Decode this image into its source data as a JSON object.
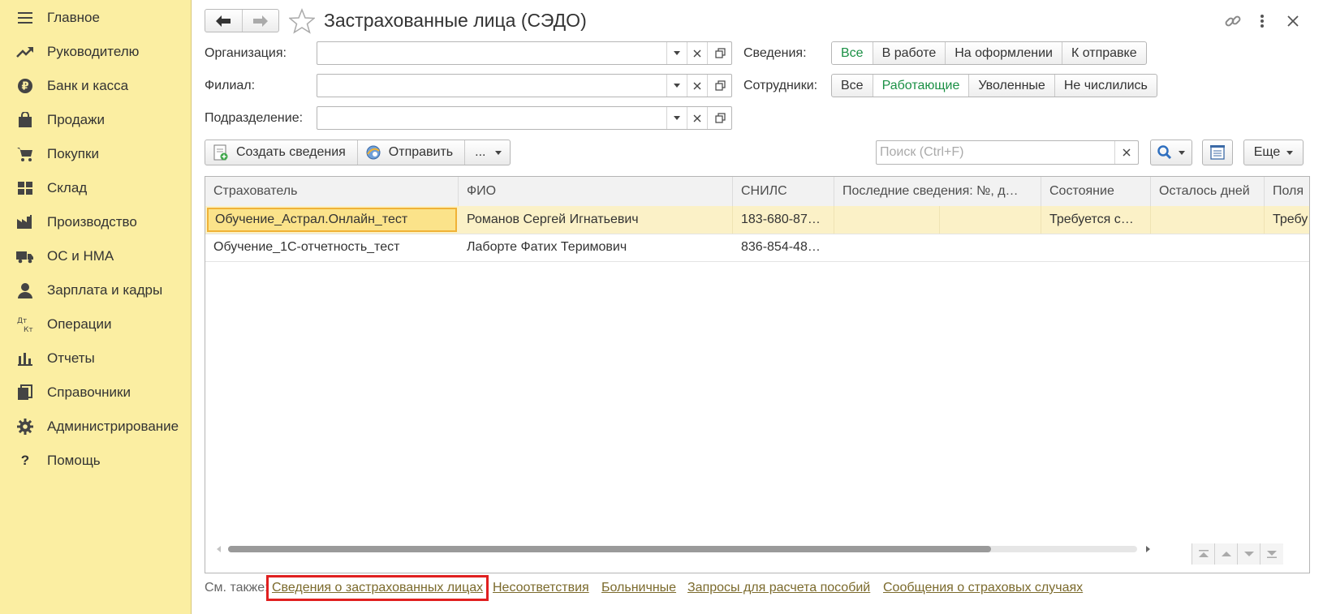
{
  "sidebar": {
    "items": [
      {
        "label": "Главное",
        "icon": "menu-icon"
      },
      {
        "label": "Руководителю",
        "icon": "trend-icon"
      },
      {
        "label": "Банк и касса",
        "icon": "ruble-icon"
      },
      {
        "label": "Продажи",
        "icon": "bag-icon"
      },
      {
        "label": "Покупки",
        "icon": "cart-icon"
      },
      {
        "label": "Склад",
        "icon": "warehouse-icon"
      },
      {
        "label": "Производство",
        "icon": "factory-icon"
      },
      {
        "label": "ОС и НМА",
        "icon": "truck-icon"
      },
      {
        "label": "Зарплата и кадры",
        "icon": "person-icon"
      },
      {
        "label": "Операции",
        "icon": "dt-kt-icon"
      },
      {
        "label": "Отчеты",
        "icon": "chart-icon"
      },
      {
        "label": "Справочники",
        "icon": "books-icon"
      },
      {
        "label": "Администрирование",
        "icon": "gear-icon"
      },
      {
        "label": "Помощь",
        "icon": "help-icon"
      }
    ],
    "dt": "Дт",
    "kt": "Кт",
    "help_glyph": "?"
  },
  "header": {
    "title": "Застрахованные лица (СЭДО)"
  },
  "filters": {
    "organization_label": "Организация:",
    "branch_label": "Филиал:",
    "department_label": "Подразделение:",
    "organization_value": "",
    "branch_value": "",
    "department_value": ""
  },
  "info_filter": {
    "label": "Сведения:",
    "options": [
      "Все",
      "В работе",
      "На оформлении",
      "К отправке"
    ],
    "active": "Все"
  },
  "employee_filter": {
    "label": "Сотрудники:",
    "options": [
      "Все",
      "Работающие",
      "Уволенные",
      "Не числились"
    ],
    "active": "Работающие"
  },
  "toolbar": {
    "create_label": "Создать сведения",
    "send_label": "Отправить",
    "more_dots": "...",
    "search_placeholder": "Поиск (Ctrl+F)",
    "more_label": "Еще"
  },
  "table": {
    "columns": [
      "Страхователь",
      "ФИО",
      "СНИЛС",
      "Последние сведения: №, д…",
      "Состояние",
      "Осталось дней",
      "Поля"
    ],
    "rows": [
      {
        "insurer": "Обучение_Астрал.Онлайн_тест",
        "name": "Романов Сергей Игнатьевич",
        "snils": "183-680-87…",
        "last": "",
        "last2": "",
        "state": "Требуется с…",
        "days": "",
        "fields": "Требу"
      },
      {
        "insurer": "Обучение_1С-отчетность_тест",
        "name": "Лаборте Фатих Теримович",
        "snils": "836-854-48…",
        "last": "",
        "last2": "",
        "state": "",
        "days": "",
        "fields": ""
      }
    ]
  },
  "see_also": {
    "label": "См. также:",
    "links": [
      "Сведения о застрахованных лицах",
      "Несоответствия",
      "Больничные",
      "Запросы для расчета пособий",
      "Сообщения о страховых случаях"
    ]
  },
  "colors": {
    "sidebar_bg": "#fbeea2",
    "active_green": "#1b9045",
    "link": "#7b6a2c",
    "highlight_red": "#e02020",
    "selected_row": "#fbf1c7"
  }
}
